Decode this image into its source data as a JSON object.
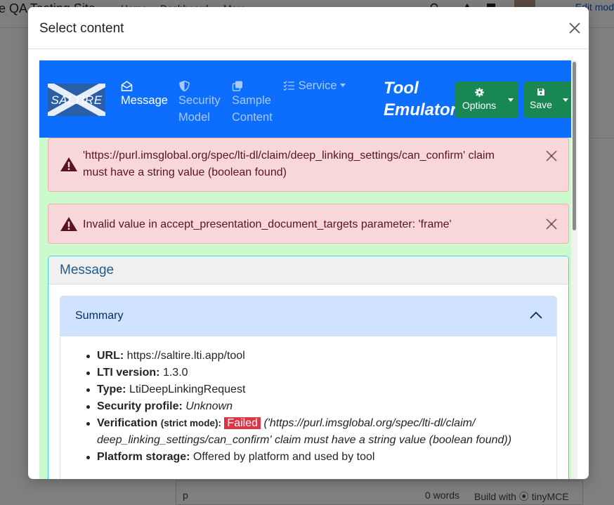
{
  "background": {
    "site_name": "e QA Testing Site",
    "nav_links": [
      "Home",
      "Dashboard",
      "More"
    ],
    "edit_mode": "Edit mod",
    "editor": {
      "tag": "p",
      "words": "0 words",
      "build": "Build with ⦿ tinyMCE"
    }
  },
  "modal": {
    "title": "Select content"
  },
  "tool": {
    "logo_text": "SALTIRE",
    "nav": {
      "message": "Message",
      "security_line1": "Security",
      "security_line2": "Model",
      "sample_line1": "Sample",
      "sample_line2": "Content",
      "service": "Service"
    },
    "title_line1": "Tool",
    "title_line2": "Emulator",
    "options_label": "Options",
    "save_label": "Save"
  },
  "alerts": [
    {
      "line1": "'https://purl.imsglobal.org/spec/lti-dl/claim/deep_linking_settings/can_confirm' claim",
      "line2": "must have a string value (boolean found)"
    },
    {
      "line1": "Invalid value in accept_presentation_document_targets parameter: 'frame'"
    }
  ],
  "message_card": {
    "title": "Message",
    "summary_title": "Summary",
    "items": {
      "url_label": "URL:",
      "url_value": "https://saltire.lti.app/tool",
      "lti_label": "LTI version:",
      "lti_value": "1.3.0",
      "type_label": "Type:",
      "type_value": "LtiDeepLinkingRequest",
      "security_label": "Security profile:",
      "security_value": "Unknown",
      "verification_label": "Verification",
      "verification_mode": "(strict mode):",
      "verification_badge": "Failed",
      "verification_detail_line1": "('https://purl.imsglobal.org/spec/lti-dl/claim/",
      "verification_detail_line2": "deep_linking_settings/can_confirm' claim must have a string value (boolean found))",
      "storage_label": "Platform storage:",
      "storage_value": "Offered by platform and used by tool"
    }
  },
  "colors": {
    "navbar": "#0d6efd",
    "success_button": "#198754",
    "alert_bg": "#f8d7da",
    "frame_bg": "#cdfacd",
    "accordion_header": "#cfe2ff",
    "badge_danger": "#dc3545"
  }
}
